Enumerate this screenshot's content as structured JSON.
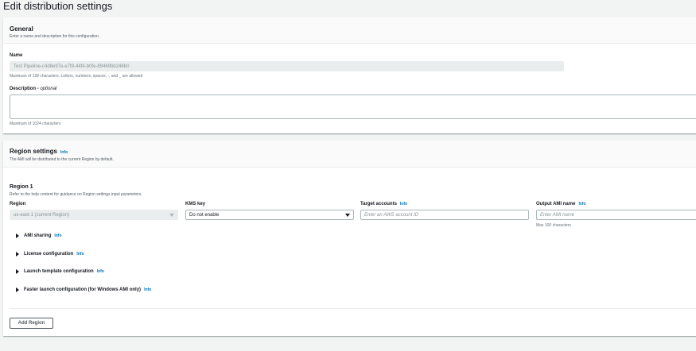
{
  "page": {
    "title": "Edit distribution settings"
  },
  "general": {
    "title": "General",
    "description": "Enter a name and description for this configuration.",
    "name_label": "Name",
    "name_value": "Test Pipeline-c4d8e97e-e7f8-44f4-b0fe-89469bb246b0",
    "name_hint": "Maximum of 128 characters. Letters, numbers, spaces, -, and _ are allowed",
    "description_label": "Description - ",
    "description_optional": "optional",
    "description_value": "",
    "description_hint": "Maximum of 1024 characters"
  },
  "region_settings": {
    "title": "Region settings",
    "info": "Info",
    "description": "The AMI will be distributed to the current Region by default.",
    "region1": {
      "title": "Region 1",
      "description": "Refer to the help content for guidance on Region settings input parameters.",
      "region_label": "Region",
      "region_value": "us-east-1 (current Region)",
      "kms_label": "KMS key",
      "kms_value": "Do not enable",
      "target_label": "Target accounts",
      "target_info": "Info",
      "target_placeholder": "Enter an AWS account ID",
      "output_label": "Output AMI name",
      "output_info": "Info",
      "output_placeholder": "Enter AMI name",
      "output_hint": "Max 100 characters"
    },
    "expanders": [
      {
        "label": "AMI sharing",
        "info": "Info"
      },
      {
        "label": "License configuration",
        "info": "Info"
      },
      {
        "label": "Launch template configuration",
        "info": "Info"
      },
      {
        "label": "Faster launch configuration (for Windows AMI only)",
        "info": "Info"
      }
    ],
    "add_region_label": "Add Region"
  }
}
